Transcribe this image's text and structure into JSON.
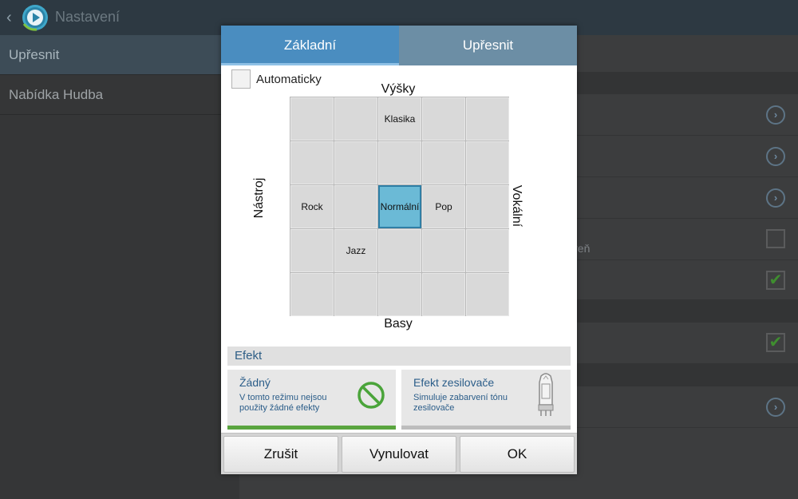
{
  "header": {
    "title": "Nastavení",
    "back_icon": "chevron-left-icon",
    "app_icon": "music-player-icon"
  },
  "sidebar": {
    "items": [
      {
        "label": "Upřesnit",
        "active": true
      },
      {
        "label": "Nabídka Hudba",
        "active": false
      }
    ]
  },
  "background_rows": {
    "partial_text": "oveň"
  },
  "dialog": {
    "tabs": [
      {
        "label": "Základní",
        "active": true
      },
      {
        "label": "Upřesnit",
        "active": false
      }
    ],
    "auto": {
      "label": "Automaticky",
      "checked": false
    },
    "axes": {
      "top": "Výšky",
      "bottom": "Basy",
      "left": "Nástroj",
      "right": "Vokální"
    },
    "grid": {
      "cells": [
        "",
        "",
        "Klasika",
        "",
        "",
        "",
        "",
        "",
        "",
        "",
        "Rock",
        "",
        "Normální",
        "Pop",
        "",
        "",
        "Jazz",
        "",
        "",
        "",
        "",
        "",
        "",
        "",
        ""
      ],
      "selected": "Normální"
    },
    "effect": {
      "heading": "Efekt",
      "cards": [
        {
          "title": "Žádný",
          "desc": "V tomto režimu nejsou použity žádné efekty",
          "icon": "no-effect-icon",
          "active": true
        },
        {
          "title": "Efekt zesilovače",
          "desc": "Simuluje zabarvení tónu zesilovače",
          "icon": "vacuum-tube-icon",
          "active": false
        }
      ]
    },
    "buttons": {
      "cancel": "Zrušit",
      "reset": "Vynulovat",
      "ok": "OK"
    }
  },
  "colors": {
    "accent": "#4a8dc0",
    "selected_cell": "#6bbad6",
    "active_bar": "#5aa53f"
  }
}
